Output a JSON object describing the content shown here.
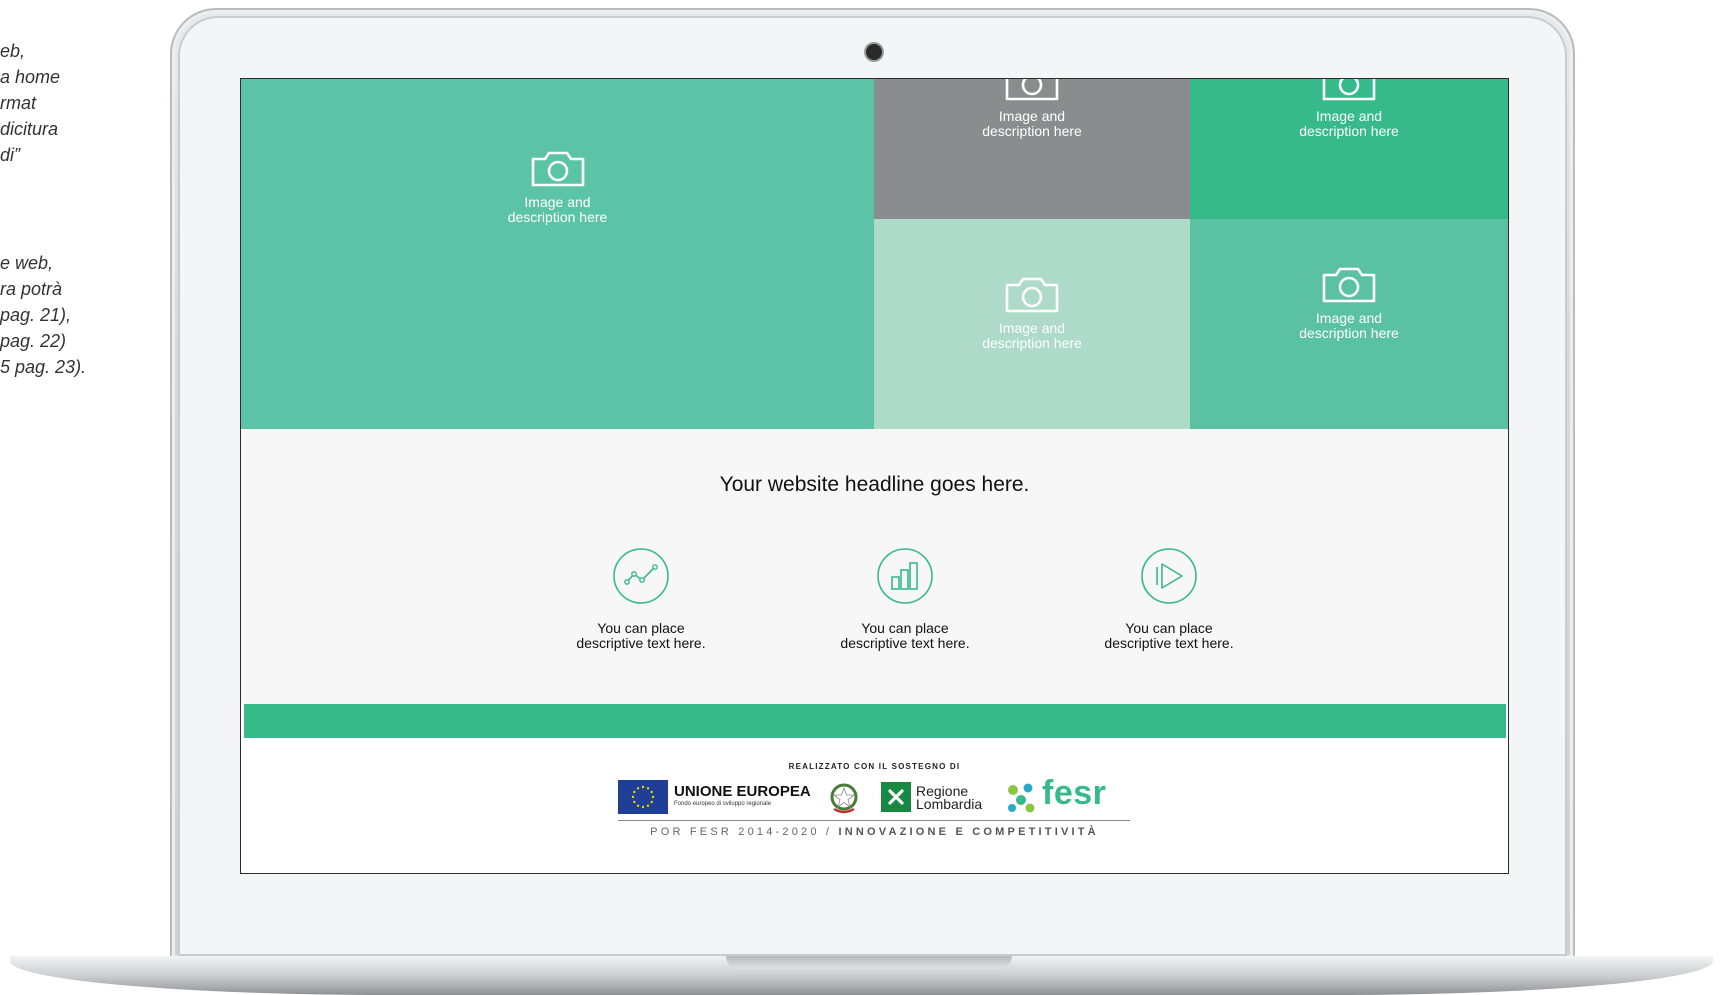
{
  "side_notes": {
    "block_a": [
      "eb,",
      "a home",
      "rmat",
      " dicitura",
      "di”"
    ],
    "block_b": [
      "e web,",
      "ra potrà",
      "pag. 21),",
      "pag. 22)",
      "5 pag. 23)."
    ]
  },
  "hero": {
    "tiles": [
      {
        "caption_line1": "Image and",
        "caption_line2": "description here"
      },
      {
        "caption_line1": "Image and",
        "caption_line2": "description here"
      },
      {
        "caption_line1": "Image and",
        "caption_line2": "description here"
      },
      {
        "caption_line1": "Image and",
        "caption_line2": "description here"
      },
      {
        "caption_line1": "Image and",
        "caption_line2": "description here"
      }
    ],
    "icon": "camera-icon"
  },
  "content": {
    "headline": "Your website headline goes here.",
    "features": [
      {
        "icon": "line-chart-icon",
        "line1": "You can place",
        "line2": "descriptive text here."
      },
      {
        "icon": "bar-chart-icon",
        "line1": "You can place",
        "line2": "descriptive text here."
      },
      {
        "icon": "play-icon",
        "line1": "You can place",
        "line2": "descriptive text here."
      }
    ]
  },
  "footer": {
    "support_label": "REALIZZATO CON IL SOSTEGNO DI",
    "eu_title": "UNIONE EUROPEA",
    "eu_subtitle": "Fondo europeo di sviluppo regionale",
    "lombardia_line1": "Regione",
    "lombardia_line2": "Lombardia",
    "fesr_label": "fesr",
    "programme_part1": "POR FESR 2014-2020 / ",
    "programme_part2": "INNOVAZIONE E COMPETITIVITÀ"
  },
  "colors": {
    "main_tile": "#5cc4a6",
    "gray_tile": "#8b8c8d",
    "green_tile": "#36ba8a",
    "light_tile": "#aedbc8",
    "accent": "#36ba8a"
  }
}
